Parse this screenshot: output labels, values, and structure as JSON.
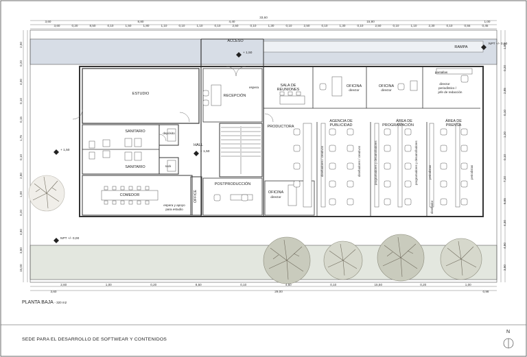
{
  "sheet": {
    "title": "SEDE PARA EL DESARROLLO DE SOFTWEAR Y CONTENIDOS",
    "plan_title": "PLANTA BAJA",
    "plan_area": "- 320 m2",
    "north": "N"
  },
  "rooms": {
    "acceso": "ACCESO",
    "rampa": "RAMPA",
    "estudio": "ESTUDIO",
    "recepcion": "RECEPCIÓN",
    "espera": "espera",
    "sala_line1": "SALA DE",
    "sala_line2": "REUNIONES",
    "oficina1_line1": "OFICINA",
    "oficina1_line2": "director",
    "oficina2_line1": "OFICINA",
    "oficina2_line2": "director",
    "pantallas": "pantallas",
    "director_line1": "director",
    "director_line2": "periodístico /",
    "director_line3": "jefe de redacción",
    "productora": "PRODUCTORA",
    "agencia_line1": "AGENCIA DE",
    "agencia_line2": "PUBLICIDAD",
    "area_prog_line1": "ÁREA DE",
    "area_prog_line2": "PROGRAMACIÓN",
    "area_prensa_line1": "ÁREA DE",
    "area_prensa_line2": "PRENSA",
    "sanitario_top": "SANITARIO",
    "sanitario_bottom": "SANITARIO",
    "deposito": "depósito",
    "rack": "rack",
    "hall": "HALL",
    "postproduccion": "POSTPRODUCCIÓN",
    "oficina3_line1": "OFICINA",
    "oficina3_line2": "director",
    "office": "OFFICE",
    "comedor": "COMEDOR",
    "espera_apoyo_line1": "espera y apoyo",
    "espera_apoyo_line2": "para estudio",
    "diseñadores_1": "diseñadores / creativos",
    "diseñadores_2": "diseñadores / creativos",
    "programadores_1": "programadores y desarrolladores",
    "programadores_2": "programadores y desarrolladores",
    "periodistas_1": "periodistas",
    "periodistas_2": "periodistas",
    "diseñador": "diseñador"
  },
  "levels": {
    "npt_top_right": "NPT +/- 0,00",
    "npt_bottom_left": "NPT +/- 0,00",
    "level_access": "+ 1,50",
    "level_hall": "+ 1,50",
    "level_left": "+ 1,50"
  },
  "dims_top": {
    "overall": "33,60",
    "row2": [
      "3,60",
      "8,80",
      "4,40",
      "15,80",
      "1,00"
    ],
    "row3": [
      "3,60",
      "0,20",
      "8,50",
      "0,10",
      "1,50",
      "1,80",
      "1,10",
      "0,10",
      "1,10",
      "0,10",
      "2,50",
      "0,10",
      "1,30",
      "0,10",
      "2,50",
      "0,10",
      "1,30",
      "0,10",
      "2,50",
      "0,10",
      "1,10",
      "2,30",
      "0,10",
      "0,55",
      "0,45"
    ]
  },
  "dims_bottom": {
    "row1": [
      "2,60",
      "1,00",
      "0,20",
      "8,50",
      "0,10",
      "4,50",
      "0,10",
      "15,50",
      "0,20",
      "1,00"
    ],
    "row2": [
      "3,60",
      "29,00",
      "0,98"
    ]
  },
  "dims_left": [
    "2,50",
    "0,20",
    "4,00",
    "0,10",
    "0,15",
    "1,75",
    "0,10",
    "2,80",
    "1,00",
    "0,20",
    "4,80",
    "3,80",
    "15,00"
  ],
  "dims_right": [
    "1,50",
    "0,20",
    "2,85",
    "0,10",
    "1,20",
    "0,10",
    "7,20",
    "6,65",
    "4,30",
    "4,80",
    "3,80"
  ],
  "colors": {
    "line": "#333333",
    "wall": "#e6e6e6",
    "sidewalk": "#d7dde6",
    "garden": "#e3e7df",
    "tree": "#6f6a5c"
  }
}
